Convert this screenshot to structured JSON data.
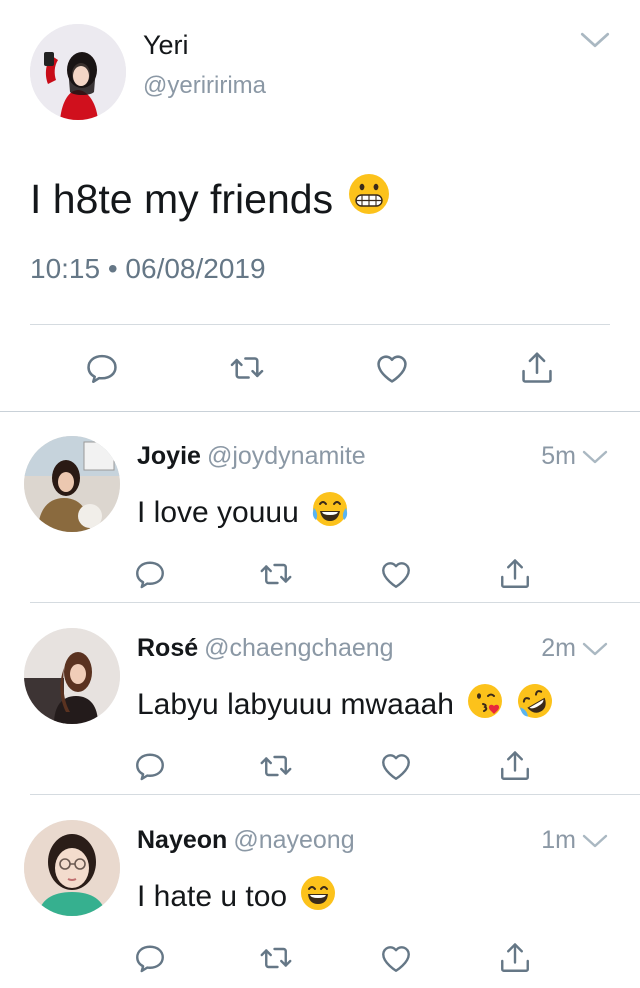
{
  "tweet": {
    "author_name": "Yeri",
    "author_handle": "@yeriririma",
    "text": "I h8te my friends",
    "text_emoji": "grimacing-face",
    "timestamp": "10:15 • 06/08/2019"
  },
  "replies": [
    {
      "name": "Joyie",
      "handle": "@joydynamite",
      "time": "5m",
      "text": "I love youuu",
      "emojis": [
        "face-with-tears-of-joy"
      ]
    },
    {
      "name": "Rosé",
      "handle": "@chaengchaeng",
      "time": "2m",
      "text": "Labyu labyuuu mwaaah",
      "emojis": [
        "face-blowing-kiss",
        "rolling-on-floor-laughing"
      ]
    },
    {
      "name": "Nayeon",
      "handle": "@nayeong",
      "time": "1m",
      "text": "I hate u too",
      "emojis": [
        "grinning-smiling-eyes"
      ]
    }
  ],
  "colors": {
    "text": "#14171a",
    "secondary": "#8b98a5",
    "icon": "#657786",
    "divider": "#d5dbe0",
    "emoji_yellow": "#fcc21b"
  }
}
